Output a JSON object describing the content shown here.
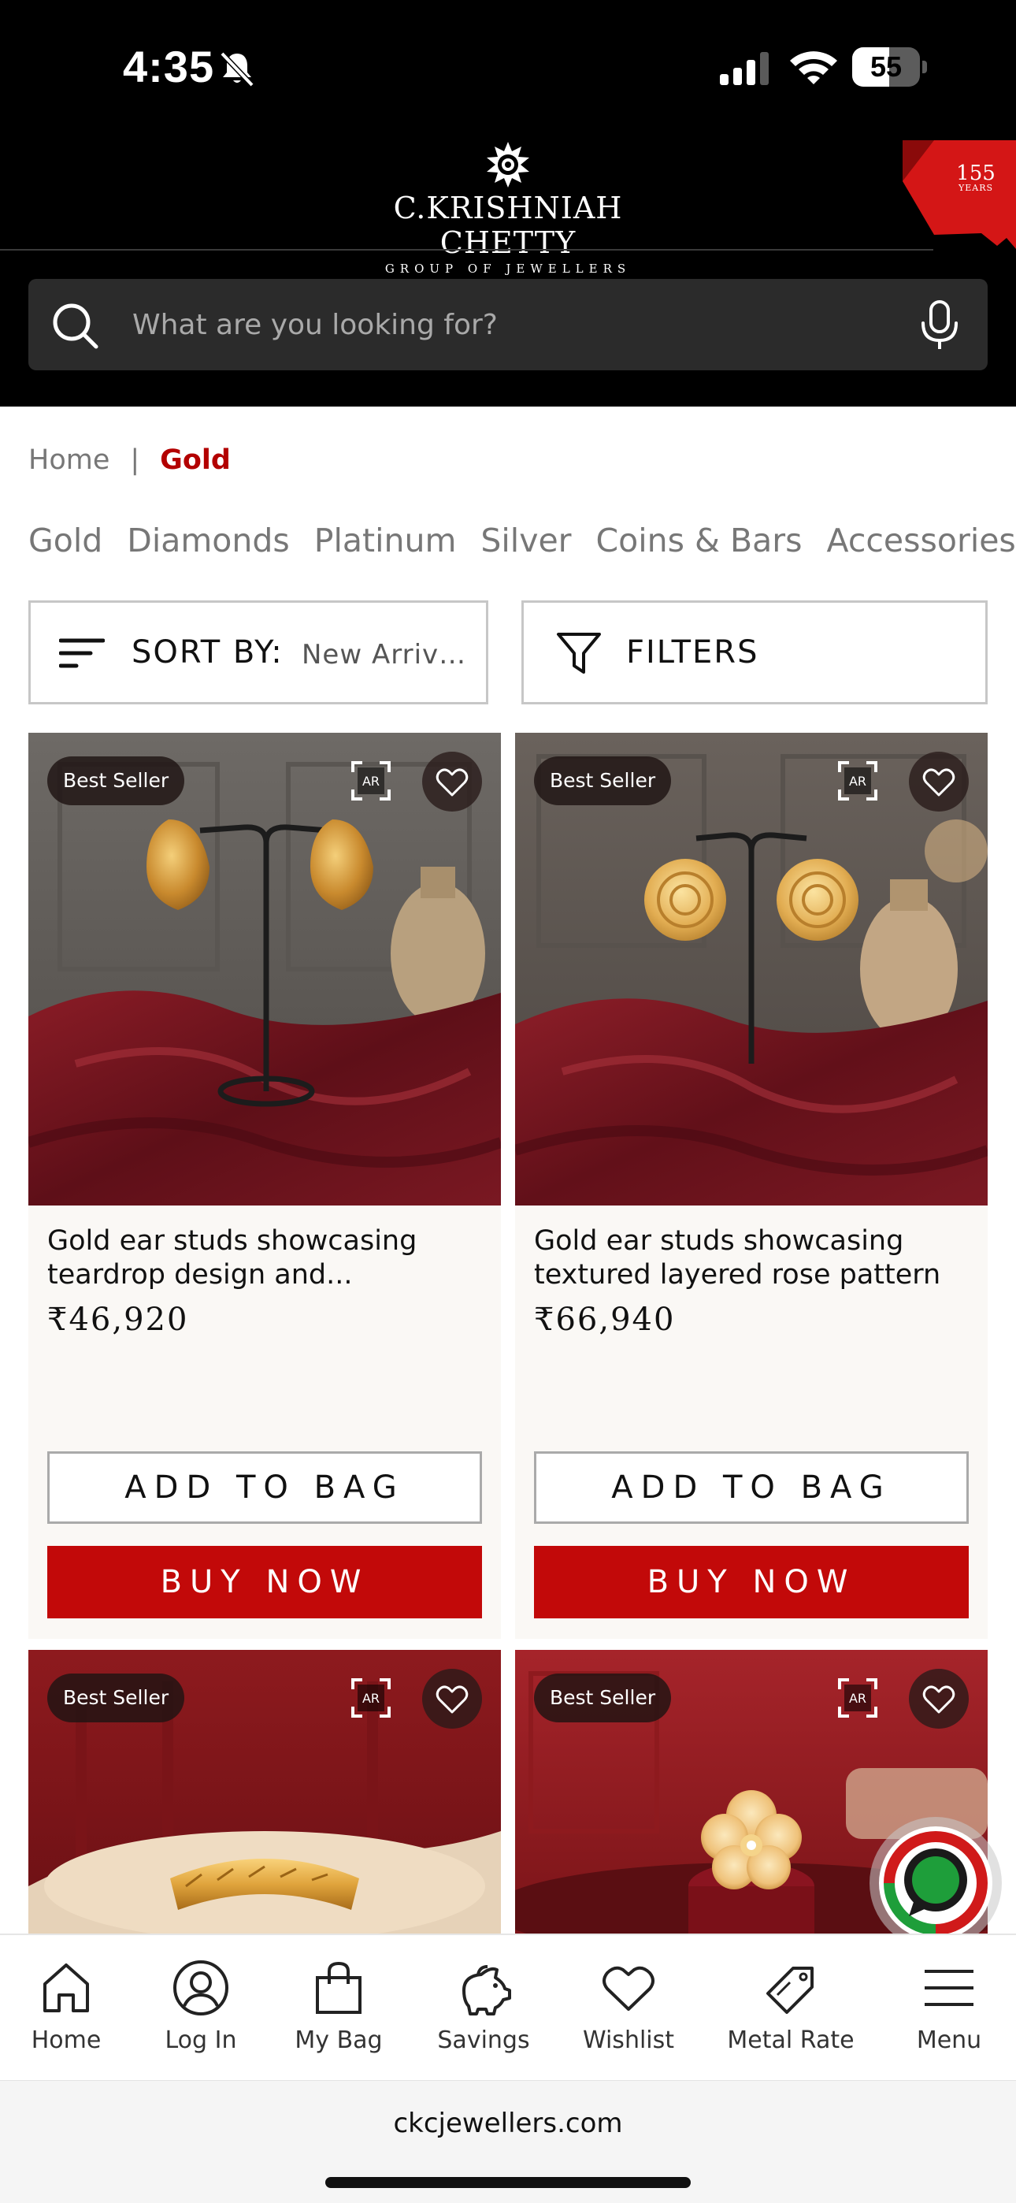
{
  "status_bar": {
    "time": "4:35",
    "battery_percent": 55,
    "battery_label": "55"
  },
  "brand": {
    "name": "C.KRISHNIAH CHETTY",
    "tagline": "GROUP OF JEWELLERS",
    "anniversary_number": "155",
    "anniversary_label": "YEARS"
  },
  "search": {
    "placeholder": "What are you looking for?"
  },
  "breadcrumb": {
    "home": "Home",
    "separator": "|",
    "current": "Gold"
  },
  "categories": [
    "Gold",
    "Diamonds",
    "Platinum",
    "Silver",
    "Coins & Bars",
    "Accessories"
  ],
  "sort": {
    "label": "SORT BY:",
    "value": "New Arrivals"
  },
  "filters": {
    "label": "FILTERS"
  },
  "ar_label": "AR",
  "products": [
    {
      "badge": "Best Seller",
      "title": "Gold ear studs showcasing teardrop design and...",
      "price": "₹46,920",
      "add_label": "ADD TO BAG",
      "buy_label": "BUY NOW"
    },
    {
      "badge": "Best Seller",
      "title": "Gold ear studs showcasing textured layered rose pattern",
      "price": "₹66,940",
      "add_label": "ADD TO BAG",
      "buy_label": "BUY NOW"
    },
    {
      "badge": "Best Seller"
    },
    {
      "badge": "Best Seller"
    }
  ],
  "bottom_nav": [
    {
      "label": "Home",
      "icon": "home-icon"
    },
    {
      "label": "Log In",
      "icon": "user-icon"
    },
    {
      "label": "My Bag",
      "icon": "bag-icon"
    },
    {
      "label": "Savings",
      "icon": "piggy-bank-icon"
    },
    {
      "label": "Wishlist",
      "icon": "heart-icon"
    },
    {
      "label": "Metal Rate",
      "icon": "price-tag-icon"
    },
    {
      "label": "Menu",
      "icon": "menu-icon"
    }
  ],
  "browser": {
    "url": "ckcjewellers.com"
  },
  "colors": {
    "brand_red": "#c20909",
    "breadcrumb_active": "#b30000",
    "header_bg": "#000000"
  }
}
